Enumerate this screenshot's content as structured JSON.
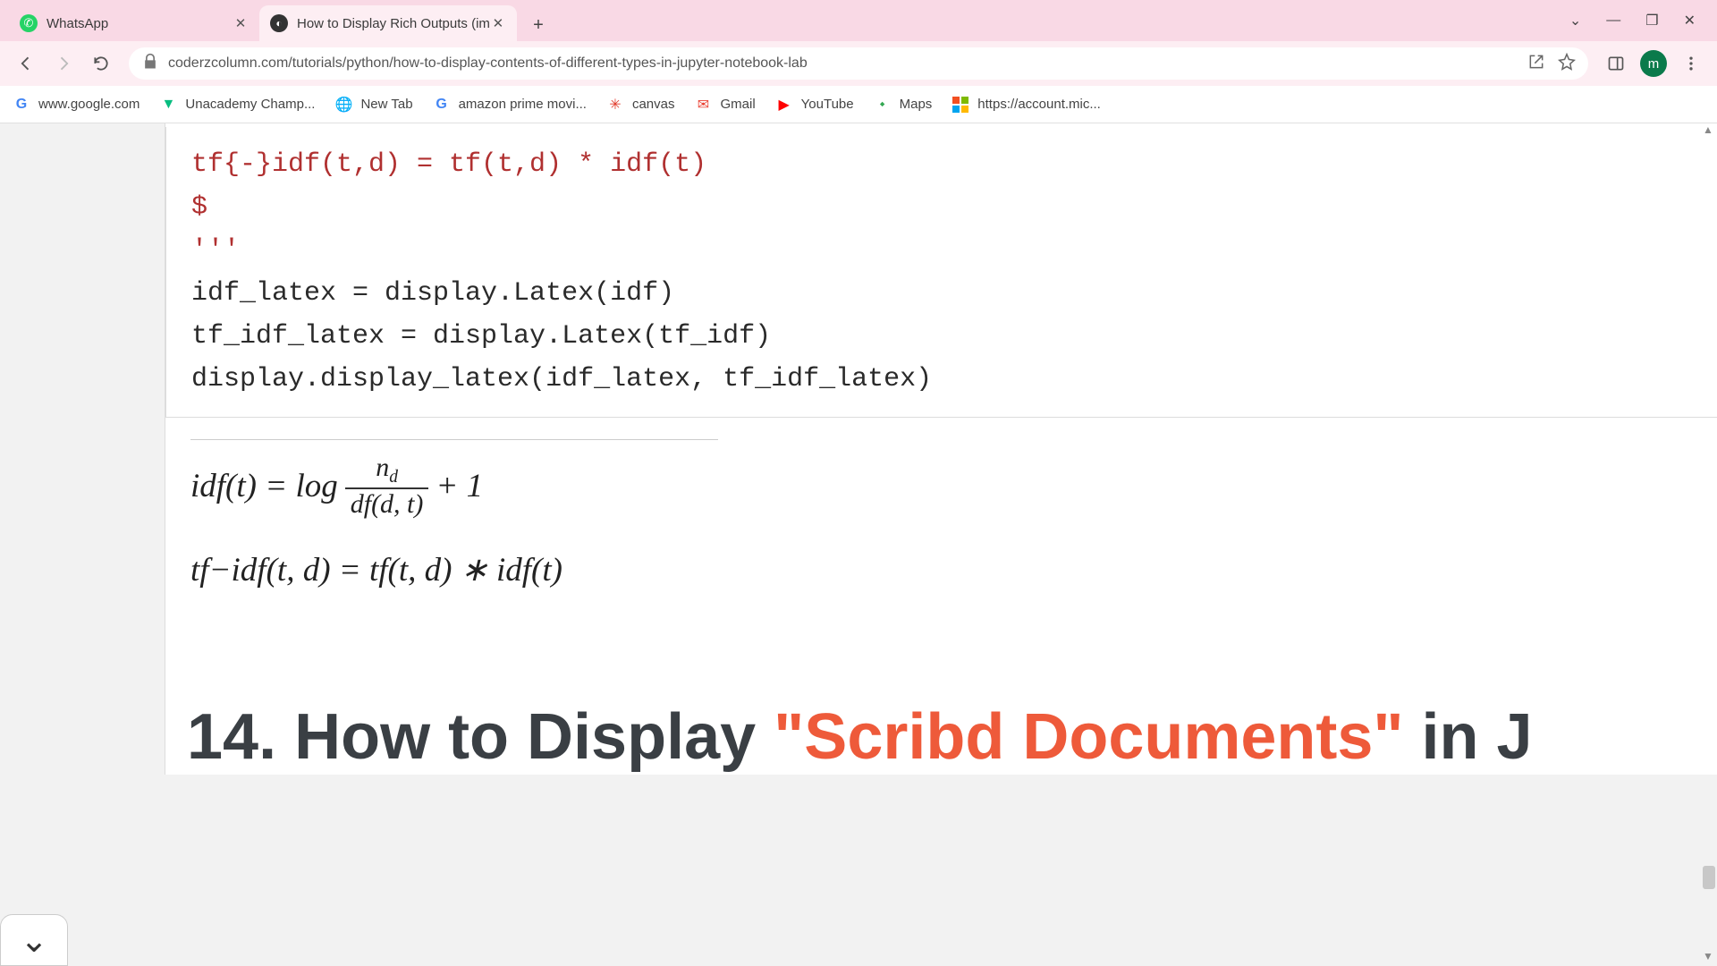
{
  "tabs": [
    {
      "title": "WhatsApp"
    },
    {
      "title": "How to Display Rich Outputs (im"
    }
  ],
  "url": "coderzcolumn.com/tutorials/python/how-to-display-contents-of-different-types-in-jupyter-notebook-lab",
  "bookmarks": [
    {
      "label": "www.google.com"
    },
    {
      "label": "Unacademy Champ..."
    },
    {
      "label": "New Tab"
    },
    {
      "label": "amazon prime movi..."
    },
    {
      "label": "canvas"
    },
    {
      "label": "Gmail"
    },
    {
      "label": "YouTube"
    },
    {
      "label": "Maps"
    },
    {
      "label": "https://account.mic..."
    }
  ],
  "code": {
    "l1": "tf{-}idf(t,d) = tf(t,d) * idf(t)",
    "l2": "$",
    "l3": "'''",
    "l4": "",
    "l5": "idf_latex = display.Latex(idf)",
    "l6": "tf_idf_latex = display.Latex(tf_idf)",
    "l7": "",
    "l8": "display.display_latex(idf_latex, tf_idf_latex)"
  },
  "math": {
    "eq1_lhs": "idf(t) = log",
    "eq1_num1": "n",
    "eq1_num2": "d",
    "eq1_den": "df(d, t)",
    "eq1_rhs": " + 1",
    "eq2": "tf−idf(t, d) = tf(t, d) ∗ idf(t)"
  },
  "heading": {
    "prefix": "14. How to Display ",
    "highlight": "\"Scribd Documents\"",
    "suffix": " in J"
  },
  "profile_initial": "m"
}
